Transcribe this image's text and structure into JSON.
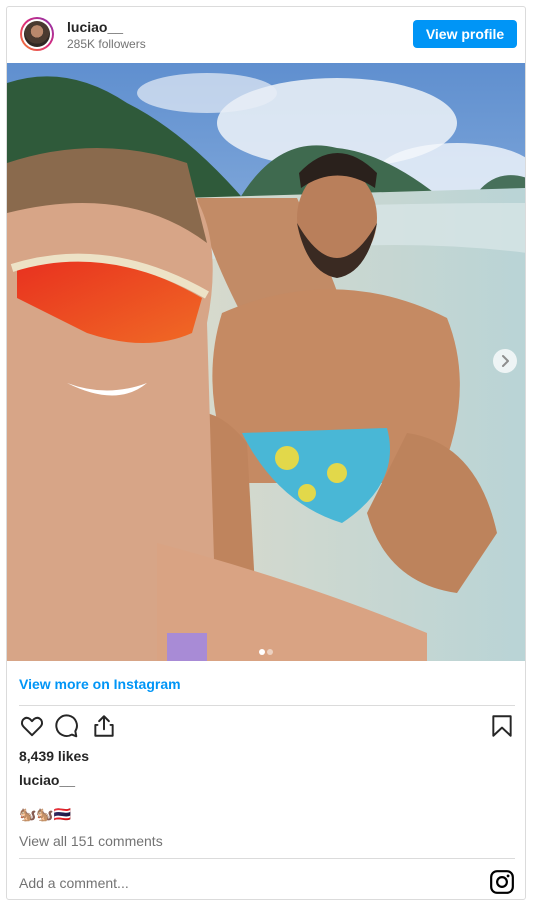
{
  "header": {
    "username": "luciao__",
    "followers": "285K followers",
    "view_profile_label": "View profile"
  },
  "carousel": {
    "total_slides": 2,
    "active_slide": 1
  },
  "footer": {
    "view_more_label": "View more on Instagram",
    "likes": "8,439 likes",
    "caption_user": "luciao__",
    "caption_emoji": "🐿️🐿️🇹🇭",
    "view_comments": "View all 151 comments",
    "add_comment_placeholder": "Add a comment..."
  },
  "icons": {
    "like": "heart-icon",
    "comment": "comment-icon",
    "share": "share-icon",
    "save": "bookmark-icon",
    "instagram": "instagram-icon",
    "next": "chevron-right-icon"
  },
  "colors": {
    "accent": "#0095f6",
    "text": "#262626",
    "muted": "#737373",
    "border": "#dbdbdb"
  }
}
